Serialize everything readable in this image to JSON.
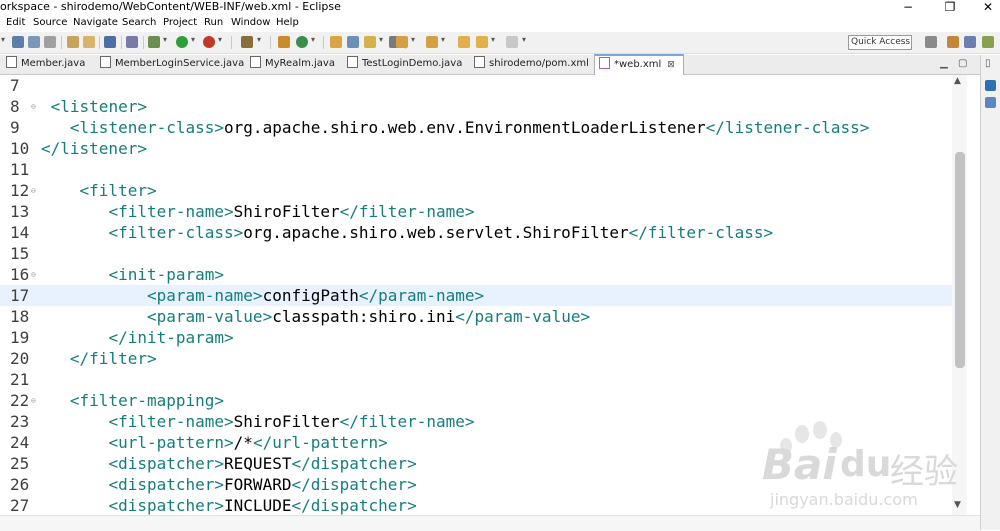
{
  "window": {
    "title": "orkspace - shirodemo/WebContent/WEB-INF/web.xml - Eclipse",
    "controls": {
      "minimize": "−",
      "maximize": "❐",
      "close": "✕"
    }
  },
  "menu": {
    "items": [
      "Edit",
      "Source",
      "Navigate",
      "Search",
      "Project",
      "Run",
      "Window",
      "Help"
    ]
  },
  "toolbar": {
    "quick_access": "Quick Access"
  },
  "tabs": [
    {
      "label": "Member.java"
    },
    {
      "label": "MemberLoginService.java"
    },
    {
      "label": "MyRealm.java"
    },
    {
      "label": "TestLoginDemo.java"
    },
    {
      "label": "shirodemo/pom.xml"
    },
    {
      "label": "*web.xml",
      "close": "⊠"
    }
  ],
  "editor": {
    "fold_marker": "⊖",
    "lines": [
      {
        "num": "7",
        "indent": "",
        "tokens": []
      },
      {
        "num": "8",
        "indent": " ",
        "tokens": [
          [
            "t",
            "<listener>"
          ]
        ]
      },
      {
        "num": "9",
        "indent": "   ",
        "tokens": [
          [
            "t",
            "<listener-class>"
          ],
          [
            "x",
            "org.apache.shiro.web.env.EnvironmentLoaderListener"
          ],
          [
            "t",
            "</listener-class>"
          ]
        ]
      },
      {
        "num": "10",
        "indent": "",
        "tokens": [
          [
            "t",
            "</listener>"
          ]
        ]
      },
      {
        "num": "11",
        "indent": "",
        "tokens": []
      },
      {
        "num": "12",
        "indent": "    ",
        "tokens": [
          [
            "t",
            "<filter>"
          ]
        ]
      },
      {
        "num": "13",
        "indent": "       ",
        "tokens": [
          [
            "t",
            "<filter-name>"
          ],
          [
            "x",
            "ShiroFilter"
          ],
          [
            "t",
            "</filter-name>"
          ]
        ]
      },
      {
        "num": "14",
        "indent": "       ",
        "tokens": [
          [
            "t",
            "<filter-class>"
          ],
          [
            "x",
            "org.apache.shiro.web.servlet.ShiroFilter"
          ],
          [
            "t",
            "</filter-class>"
          ]
        ]
      },
      {
        "num": "15",
        "indent": "",
        "tokens": []
      },
      {
        "num": "16",
        "indent": "       ",
        "tokens": [
          [
            "t",
            "<init-param>"
          ]
        ]
      },
      {
        "num": "17",
        "indent": "           ",
        "tokens": [
          [
            "t",
            "<param-name>"
          ],
          [
            "x",
            "configPath"
          ],
          [
            "t",
            "</param-name>"
          ]
        ]
      },
      {
        "num": "18",
        "indent": "           ",
        "tokens": [
          [
            "t",
            "<param-value>"
          ],
          [
            "x",
            "classpath:shiro.ini"
          ],
          [
            "t",
            "</param-value>"
          ]
        ]
      },
      {
        "num": "19",
        "indent": "       ",
        "tokens": [
          [
            "t",
            "</init-param>"
          ]
        ]
      },
      {
        "num": "20",
        "indent": "   ",
        "tokens": [
          [
            "t",
            "</filter>"
          ]
        ]
      },
      {
        "num": "21",
        "indent": "",
        "tokens": []
      },
      {
        "num": "22",
        "indent": "   ",
        "tokens": [
          [
            "t",
            "<filter-mapping>"
          ]
        ]
      },
      {
        "num": "23",
        "indent": "       ",
        "tokens": [
          [
            "t",
            "<filter-name>"
          ],
          [
            "x",
            "ShiroFilter"
          ],
          [
            "t",
            "</filter-name>"
          ]
        ]
      },
      {
        "num": "24",
        "indent": "       ",
        "tokens": [
          [
            "t",
            "<url-pattern>"
          ],
          [
            "x",
            "/*"
          ],
          [
            "t",
            "</url-pattern>"
          ]
        ]
      },
      {
        "num": "25",
        "indent": "       ",
        "tokens": [
          [
            "t",
            "<dispatcher>"
          ],
          [
            "x",
            "REQUEST"
          ],
          [
            "t",
            "</dispatcher>"
          ]
        ]
      },
      {
        "num": "26",
        "indent": "       ",
        "tokens": [
          [
            "t",
            "<dispatcher>"
          ],
          [
            "x",
            "FORWARD"
          ],
          [
            "t",
            "</dispatcher>"
          ]
        ]
      },
      {
        "num": "27",
        "indent": "       ",
        "tokens": [
          [
            "t",
            "<dispatcher>"
          ],
          [
            "x",
            "INCLUDE"
          ],
          [
            "t",
            "</dispatcher>"
          ]
        ]
      }
    ],
    "current_line": "17",
    "folding_lines": [
      "8",
      "12",
      "16",
      "22"
    ]
  },
  "watermark": {
    "brand": "Bai",
    "brand2": "du",
    "cn": "经验",
    "url": "jingyan.baidu.com"
  },
  "colors": {
    "tag": "#167d7d",
    "text": "#000000",
    "current_line_bg": "#e8f2fe",
    "accent": "#7da7d8"
  }
}
